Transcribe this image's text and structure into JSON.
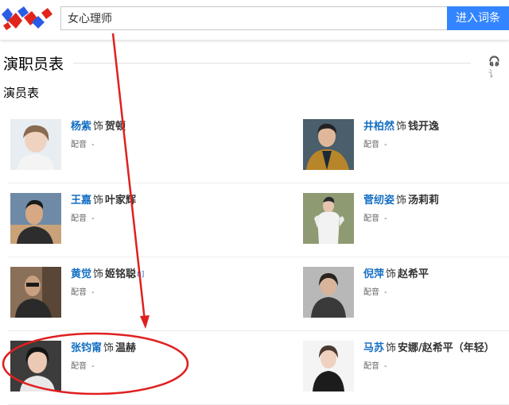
{
  "header": {
    "search_value": "女心理师",
    "search_button": "进入词条",
    "logo_colors": [
      "#e1251b",
      "#2b5ce6"
    ]
  },
  "section": {
    "title": "演职员表",
    "listen_label": "讠",
    "cast_heading": "演员表"
  },
  "cast": [
    {
      "left": {
        "actor": "杨紫",
        "as": "饰",
        "role": "贺顿",
        "dub_label": "配音",
        "dubber": "-",
        "note": ""
      },
      "right": {
        "actor": "井柏然",
        "as": "饰",
        "role": "钱开逸",
        "dub_label": "配音",
        "dubber": "-",
        "note": ""
      }
    },
    {
      "left": {
        "actor": "王嘉",
        "as": "饰",
        "role": "叶家辉",
        "dub_label": "配音",
        "dubber": "-",
        "note": ""
      },
      "right": {
        "actor": "菅纫姿",
        "as": "饰",
        "role": "汤莉莉",
        "dub_label": "配音",
        "dubber": "-",
        "note": ""
      }
    },
    {
      "left": {
        "actor": "黄觉",
        "as": "饰",
        "role": "姬铭聪",
        "dub_label": "配音",
        "dubber": "-",
        "note": "8]"
      },
      "right": {
        "actor": "倪萍",
        "as": "饰",
        "role": "赵希平",
        "dub_label": "配音",
        "dubber": "-",
        "note": ""
      }
    },
    {
      "left": {
        "actor": "张钧甯",
        "as": "饰",
        "role": "温赫",
        "dub_label": "配音",
        "dubber": "-",
        "note": ""
      },
      "right": {
        "actor": "马苏",
        "as": "饰",
        "role": "安娜/赵希平（年轻）",
        "dub_label": "配音",
        "dubber": "-",
        "note": ""
      }
    }
  ],
  "annotation": {
    "color": "#e02020"
  }
}
